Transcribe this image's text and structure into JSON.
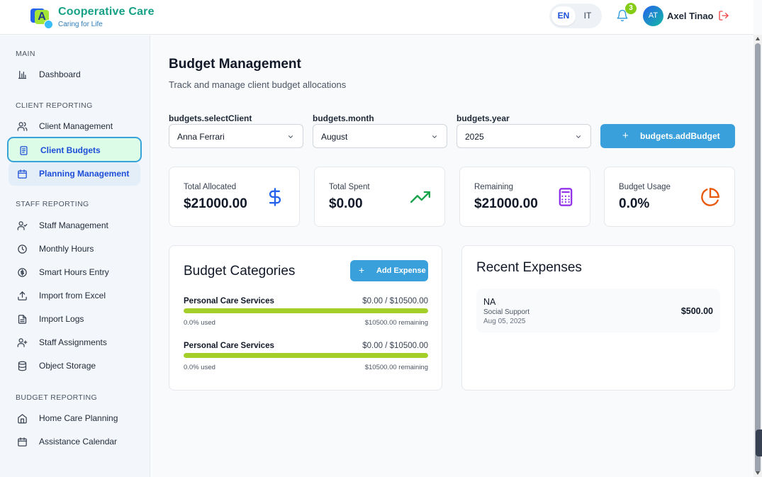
{
  "header": {
    "brand": "Cooperative Care",
    "tagline": "Caring for Life",
    "lang_en": "EN",
    "lang_it": "IT",
    "notifications_count": "3",
    "avatar_initials": "AT",
    "user_name": "Axel Tinao"
  },
  "sidebar": {
    "sections": {
      "main": "MAIN",
      "client_reporting": "CLIENT REPORTING",
      "staff_reporting": "STAFF REPORTING",
      "budget_reporting": "BUDGET REPORTING"
    },
    "items": {
      "dashboard": "Dashboard",
      "client_management": "Client Management",
      "client_budgets": "Client Budgets",
      "planning_management": "Planning Management",
      "staff_management": "Staff Management",
      "monthly_hours": "Monthly Hours",
      "smart_hours_entry": "Smart Hours Entry",
      "import_excel": "Import from Excel",
      "import_logs": "Import Logs",
      "staff_assignments": "Staff Assignments",
      "object_storage": "Object Storage",
      "home_care_planning": "Home Care Planning",
      "assistance_calendar": "Assistance Calendar"
    }
  },
  "main": {
    "title": "Budget Management",
    "subtitle": "Track and manage client budget allocations",
    "filters": {
      "client_label": "budgets.selectClient",
      "client_value": "Anna Ferrari",
      "month_label": "budgets.month",
      "month_value": "August",
      "year_label": "budgets.year",
      "year_value": "2025"
    },
    "add_budget_label": "budgets.addBudget",
    "stats": {
      "allocated_label": "Total Allocated",
      "allocated_value": "$21000.00",
      "spent_label": "Total Spent",
      "spent_value": "$0.00",
      "remaining_label": "Remaining",
      "remaining_value": "$21000.00",
      "usage_label": "Budget Usage",
      "usage_value": "0.0%"
    },
    "categories": {
      "title": "Budget Categories",
      "add_expense_label": "Add Expense",
      "items": [
        {
          "name": "Personal Care Services",
          "amount": "$0.00 / $10500.00",
          "used": "0.0% used",
          "remaining": "$10500.00 remaining",
          "fill_fraction": 1.0
        },
        {
          "name": "Personal Care Services",
          "amount": "$0.00 / $10500.00",
          "used": "0.0% used",
          "remaining": "$10500.00 remaining",
          "fill_fraction": 1.0
        }
      ]
    },
    "recent": {
      "title": "Recent Expenses",
      "items": [
        {
          "name": "NA",
          "category": "Social Support",
          "date": "Aug 05, 2025",
          "amount": "$500.00"
        }
      ]
    }
  },
  "colors": {
    "accent": "#3aa0dc",
    "brand": "#16a085",
    "progress": "#a3cf28",
    "active_bg": "#dcfce7"
  }
}
